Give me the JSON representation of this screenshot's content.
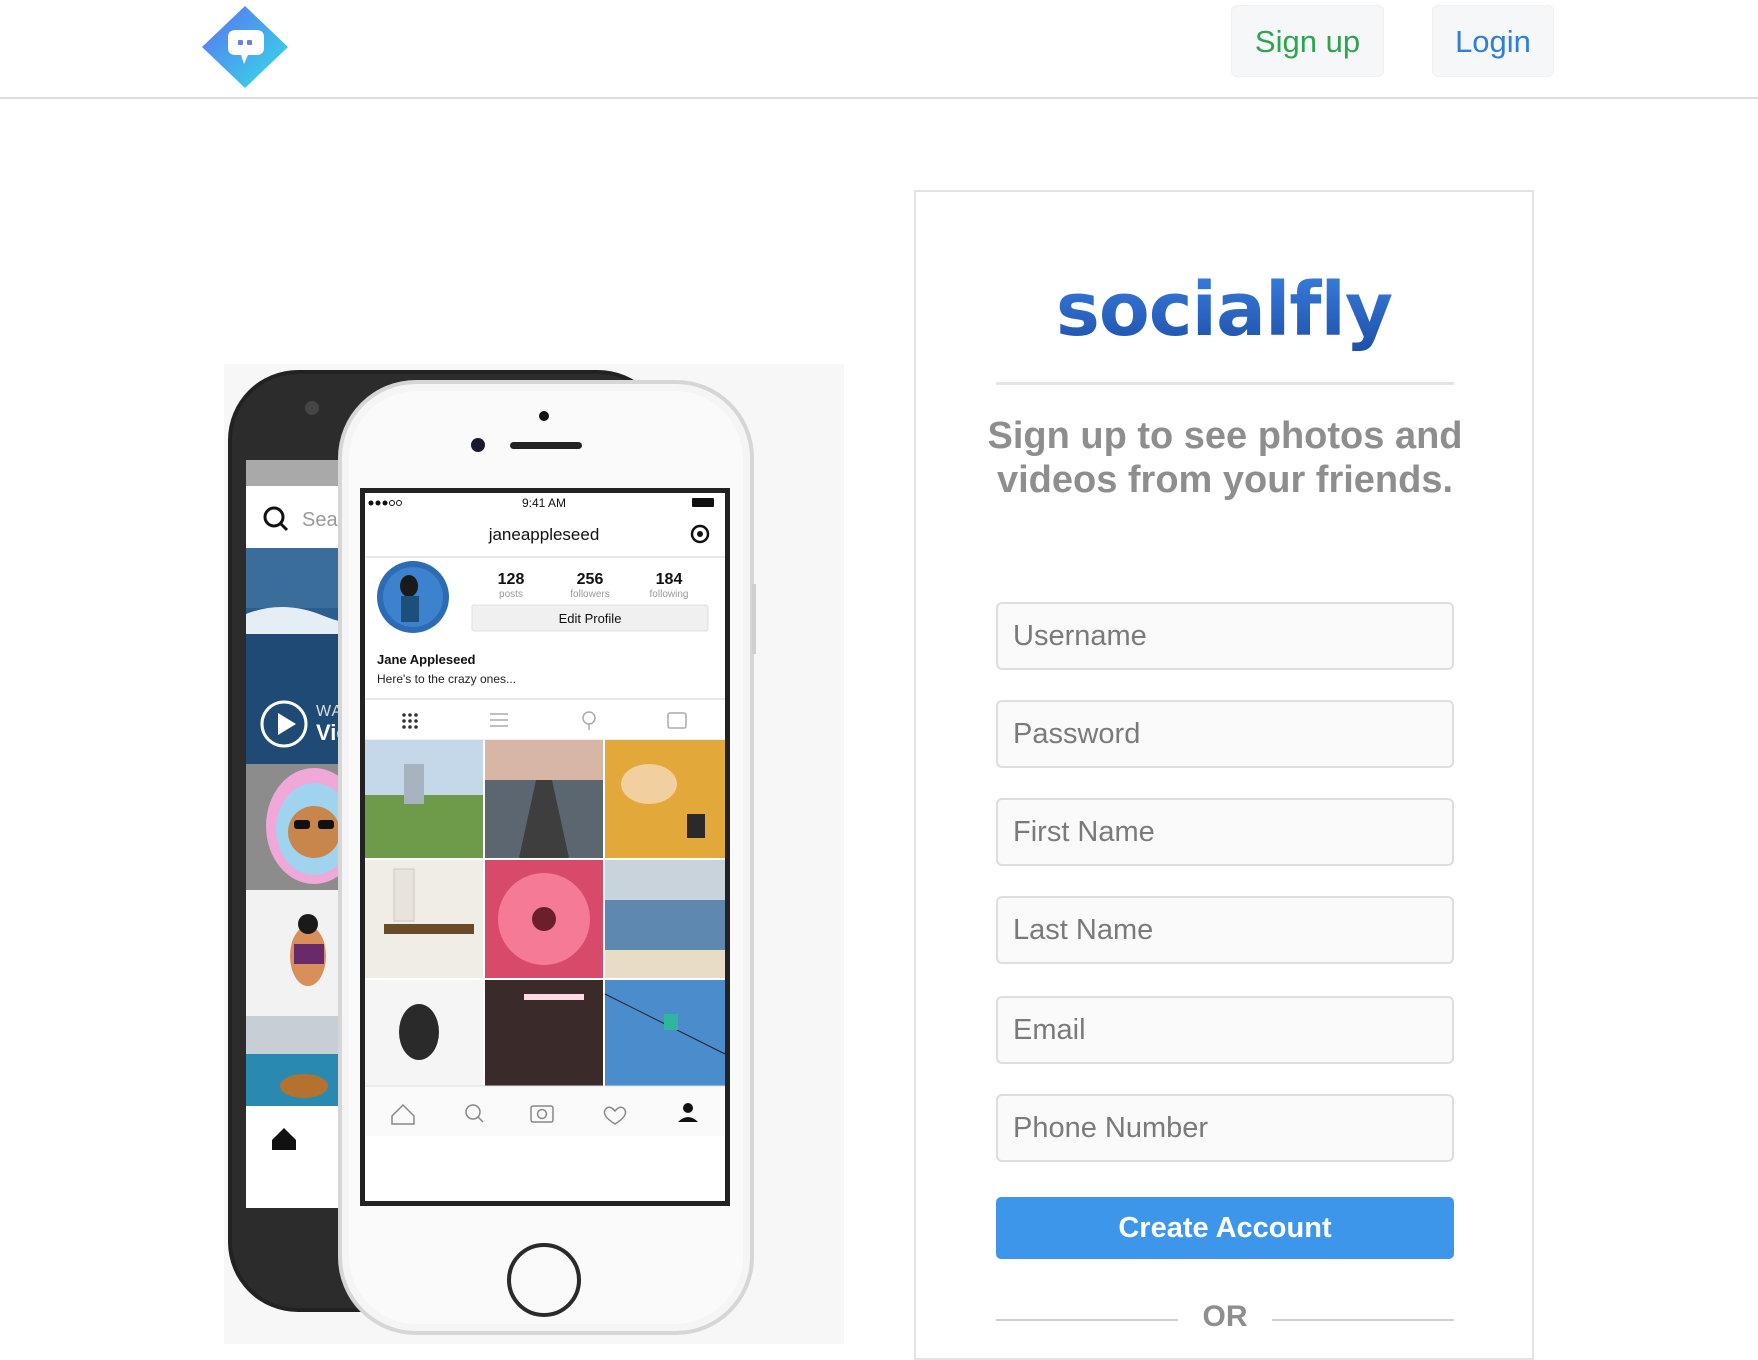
{
  "nav": {
    "signup_label": "Sign up",
    "login_label": "Login"
  },
  "phones": {
    "back_phone": {
      "search_placeholder": "Search",
      "watch_label": "WATCH",
      "video_label": "Video"
    },
    "front_phone": {
      "status_time": "9:41 AM",
      "username": "janeappleseed",
      "stats": [
        {
          "value": "128",
          "label": "posts"
        },
        {
          "value": "256",
          "label": "followers"
        },
        {
          "value": "184",
          "label": "following"
        }
      ],
      "edit_profile_label": "Edit Profile",
      "display_name": "Jane Appleseed",
      "bio": "Here's to the crazy ones..."
    }
  },
  "signup": {
    "wordmark": "socialfly",
    "headline": "Sign up to see photos and videos from your friends.",
    "fields": {
      "username": "Username",
      "password": "Password",
      "first_name": "First Name",
      "last_name": "Last Name",
      "email": "Email",
      "phone": "Phone Number"
    },
    "create_label": "Create Account",
    "or_label": "OR"
  },
  "colors": {
    "signup_green": "#2da44e",
    "login_blue": "#2f7fd6",
    "button_blue": "#3d96ea",
    "text_gray": "#8e8e8e"
  }
}
